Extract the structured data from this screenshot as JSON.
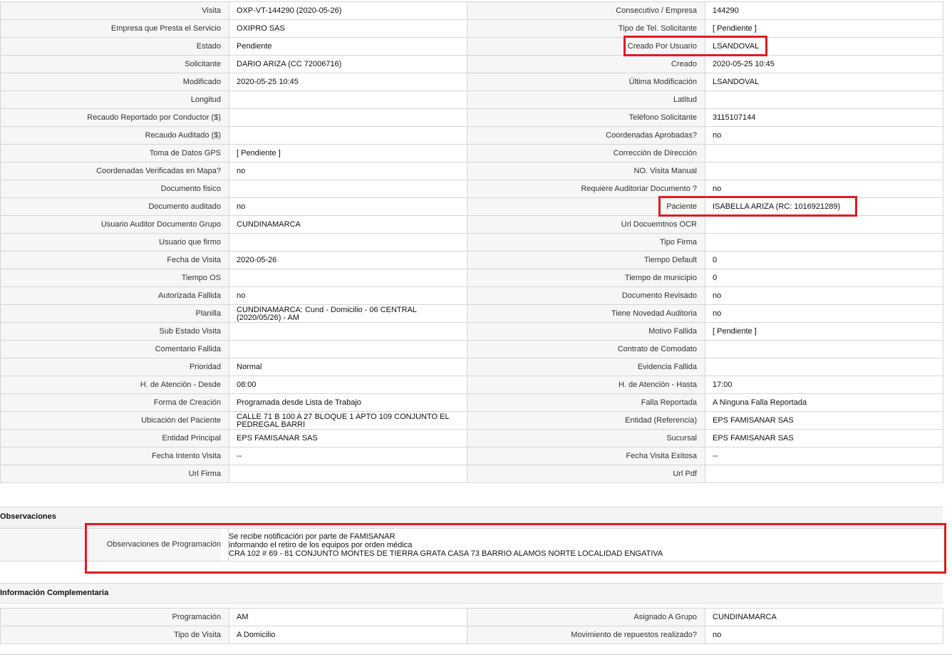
{
  "rows": [
    {
      "l1": "Visita",
      "v1": "OXP-VT-144290 (2020-05-26)",
      "l2": "Consecutivo / Empresa",
      "v2": "144290"
    },
    {
      "l1": "Empresa que Presta el Servicio",
      "v1": "OXIPRO SAS",
      "l2": "Tipo de Tel. Solicitante",
      "v2": "[ Pendiente ]"
    },
    {
      "l1": "Estado",
      "v1": "Pendiente",
      "l2": "Creado Por Usuario",
      "v2": "LSANDOVAL"
    },
    {
      "l1": "Solicitante",
      "v1": "DARIO ARIZA (CC 72006716)",
      "l2": "Creado",
      "v2": "2020-05-25 10:45"
    },
    {
      "l1": "Modificado",
      "v1": "2020-05-25 10:45",
      "l2": "Última Modificación",
      "v2": " LSANDOVAL"
    },
    {
      "l1": "Longitud",
      "v1": "",
      "l2": "Latitud",
      "v2": ""
    },
    {
      "l1": "Recaudo Reportado por Conductor ($)",
      "v1": "",
      "l2": "Teléfono Solicitante",
      "v2": "3115107144"
    },
    {
      "l1": "Recaudo Auditado ($)",
      "v1": "",
      "l2": "Coordenadas Aprobadas?",
      "v2": " no"
    },
    {
      "l1": "Toma de Datos GPS",
      "v1": "[ Pendiente ]",
      "l2": "Corrección de Dirección",
      "v2": ""
    },
    {
      "l1": "Coordenadas Verificadas en Mapa?",
      "v1": " no",
      "l2": "NO. Visita Manual",
      "v2": ""
    },
    {
      "l1": "Documento fisico",
      "v1": "",
      "l2": "Requiere Auditoriar Documento ?",
      "v2": " no"
    },
    {
      "l1": "Documento auditado",
      "v1": " no",
      "l2": "Paciente",
      "v2": "ISABELLA ARIZA (RC: 1016921289)"
    },
    {
      "l1": "Usuario Auditor Documento Grupo",
      "v1": "CUNDINAMARCA",
      "l2": "Url Docuemtnos OCR",
      "v2": ""
    },
    {
      "l1": "Usuario que firmo",
      "v1": "",
      "l2": "Tipo Firma",
      "v2": ""
    },
    {
      "l1": "Fecha de Visita",
      "v1": " 2020-05-26",
      "l2": "Tiempo Default",
      "v2": "0"
    },
    {
      "l1": "Tiempo OS",
      "v1": "",
      "l2": "Tiempo de municipio",
      "v2": "0"
    },
    {
      "l1": "Autorizada Fallida",
      "v1": " no",
      "l2": "Documento Revisado",
      "v2": " no"
    },
    {
      "l1": "Planilla",
      "v1": "CUNDINAMARCA: Cund - Domicilio - 06 CENTRAL (2020/05/26) - AM",
      "l2": "Tiene Novedad Auditoria",
      "v2": " no"
    },
    {
      "l1": "Sub Estado Visita",
      "v1": "",
      "l2": "Motivo Fallida",
      "v2": "[ Pendiente ]"
    },
    {
      "l1": "Comentario Fallida",
      "v1": "",
      "l2": "Contrato de Comodato",
      "v2": ""
    },
    {
      "l1": "Prioridad",
      "v1": "Normal",
      "l2": "Evidencia Fallida",
      "v2": ""
    },
    {
      "l1": "H. de Atención - Desde",
      "v1": "08:00",
      "l2": "H. de Atención - Hasta",
      "v2": "17:00"
    },
    {
      "l1": "Forma de Creación",
      "v1": "Programada desde Lista de Trabajo",
      "l2": "Falla Reportada",
      "v2": "A Ninguna Falla Reportada"
    },
    {
      "l1": "Ubicación del Paciente",
      "v1": "CALLE 71 B 100 A 27 BLOQUE 1 APTO 109 CONJUNTO EL PEDREGAL BARRI",
      "l2": "Entidad (Referencia)",
      "v2": "EPS FAMISANAR SAS"
    },
    {
      "l1": "Entidad Principal",
      "v1": "EPS FAMISANAR SAS",
      "l2": "Sucursal",
      "v2": "EPS FAMISANAR SAS"
    },
    {
      "l1": "Fecha Intento Visita",
      "v1": " --",
      "l2": "Fecha Visita Exitosa",
      "v2": " --"
    },
    {
      "l1": "Url Firma",
      "v1": "",
      "l2": "Url Pdf",
      "v2": ""
    }
  ],
  "observaciones": {
    "title": "Observaciones",
    "label": "Observaciones de Programación",
    "value": "  Se recibe notificación por parte de FAMISANAR\ninformando el retiro de los equipos por orden médica\nCRA 102 # 69 - 81 CONJUNTO MONTES DE TIERRA GRATA CASA 73 BARRIO ALAMOS NORTE LOCALIDAD ENGATIVA"
  },
  "complementaria": {
    "title": "Información Complementaria",
    "rows": [
      {
        "l1": "Programación",
        "v1": "AM",
        "l2": "Asignado A Grupo",
        "v2": "CUNDINAMARCA"
      },
      {
        "l1": "Tipo de Visita",
        "v1": "A Domicilio",
        "l2": "Movimiento de repuestos realizado?",
        "v2": " no"
      }
    ]
  },
  "highlight_color": "#e01b24"
}
